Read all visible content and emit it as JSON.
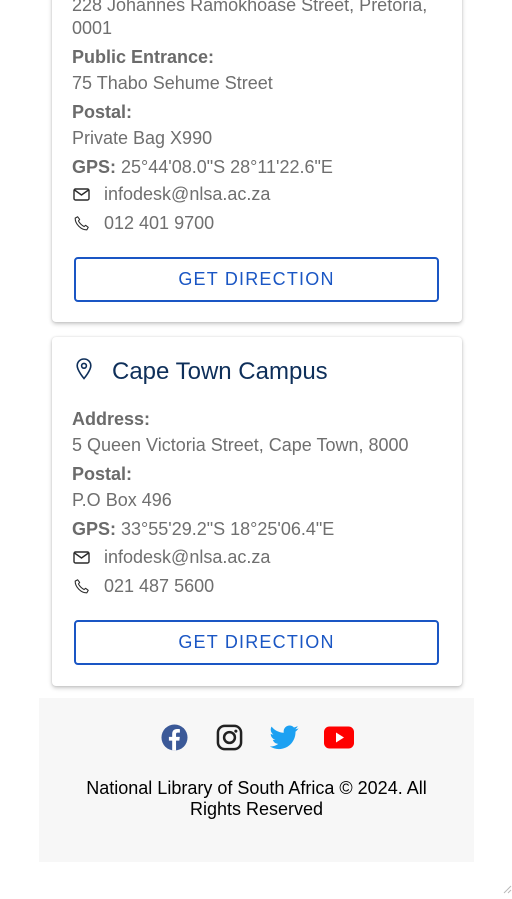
{
  "pretoria": {
    "address_tail": "228 Johannes Ramokhoase Street, Pretoria,",
    "address_code": "0001",
    "public_label": "Public Entrance:",
    "public_value": "75 Thabo Sehume Street",
    "postal_label": "Postal:",
    "postal_value": "Private Bag X990",
    "gps_label": "GPS:",
    "gps_value": "25°44'08.0\"S 28°11'22.6\"E",
    "email": "infodesk@nlsa.ac.za",
    "phone": "012 401 9700",
    "button": "GET DIRECTION"
  },
  "capetown": {
    "title": "Cape Town Campus",
    "address_label": "Address:",
    "address_value": "5 Queen Victoria Street, Cape Town, 8000",
    "postal_label": "Postal:",
    "postal_value": "P.O Box 496",
    "gps_label": "GPS:",
    "gps_value": "33°55'29.2\"S 18°25'06.4\"E",
    "email": "infodesk@nlsa.ac.za",
    "phone": "021 487 5600",
    "button": "GET DIRECTION"
  },
  "footer": {
    "social": [
      "facebook",
      "instagram",
      "twitter",
      "youtube"
    ],
    "colors": {
      "facebook": "#3b5998",
      "instagram": "#222222",
      "twitter": "#1da1f2",
      "youtube": "#ff0000"
    },
    "copyright": "National Library of South Africa © 2024. All Rights Reserved"
  }
}
